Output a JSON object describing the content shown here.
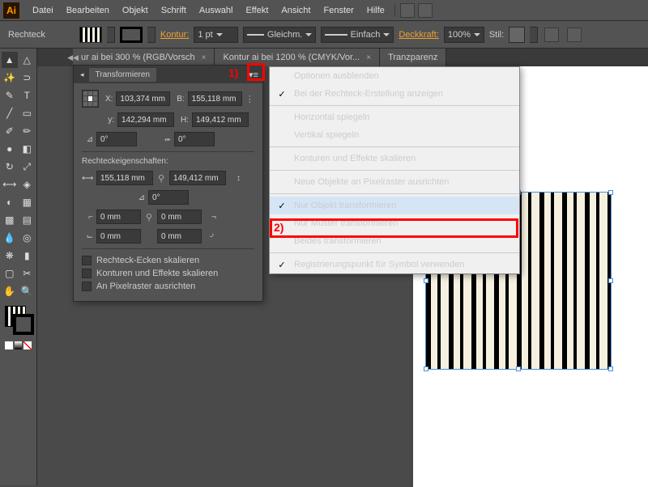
{
  "menubar": {
    "items": [
      "Datei",
      "Bearbeiten",
      "Objekt",
      "Schrift",
      "Auswahl",
      "Effekt",
      "Ansicht",
      "Fenster",
      "Hilfe"
    ]
  },
  "controlbar": {
    "shape": "Rechteck",
    "stroke_label": "Kontur:",
    "stroke_val": "1 pt",
    "dash1": "Gleichm.",
    "dash2": "Einfach",
    "opacity_label": "Deckkraft:",
    "opacity_val": "100%",
    "style_label": "Stil:"
  },
  "tabs": [
    {
      "label": "ur ai bei 300 % (RGB/Vorsch"
    },
    {
      "label": "Kontur ai bei 1200 % (CMYK/Vor..."
    },
    {
      "label": "Tranzparenz"
    }
  ],
  "panel": {
    "title": "Transformieren",
    "x_label": "X:",
    "x_val": "103,374 mm",
    "y_label": "y:",
    "y_val": "142,294 mm",
    "b_label": "B:",
    "b_val": "155,118 mm",
    "h_label": "H:",
    "h_val": "149,412 mm",
    "ang1": "0°",
    "ang2": "0°",
    "sect": "Rechteckeigenschaften:",
    "rw": "155,118 mm",
    "rh": "149,412 mm",
    "rang": "0°",
    "c1": "0 mm",
    "c2": "0 mm",
    "c3": "0 mm",
    "c4": "0 mm",
    "cb1": "Rechteck-Ecken skalieren",
    "cb2": "Konturen und Effekte skalieren",
    "cb3": "An Pixelraster ausrichten"
  },
  "flyout": {
    "items": [
      {
        "label": "Optionen ausblenden",
        "check": false
      },
      {
        "label": "Bei der Rechteck-Erstellung anzeigen",
        "check": true,
        "sep": true
      },
      {
        "label": "Horizontal spiegeln",
        "check": false
      },
      {
        "label": "Vertikal spiegeln",
        "check": false,
        "sep": true
      },
      {
        "label": "Konturen und Effekte skalieren",
        "check": false,
        "sep": true
      },
      {
        "label": "Neue Objekte an Pixelraster ausrichten",
        "check": false,
        "sep": true
      },
      {
        "label": "Nur Objekt transformieren",
        "check": true
      },
      {
        "label": "Nur Muster transformieren",
        "check": false,
        "hl": true
      },
      {
        "label": "Beides transformieren",
        "check": false,
        "sep": true
      },
      {
        "label": "Registrierungspunkt für Symbol verwenden",
        "check": true
      }
    ]
  },
  "annot": {
    "one": "1)",
    "two": "2)"
  }
}
